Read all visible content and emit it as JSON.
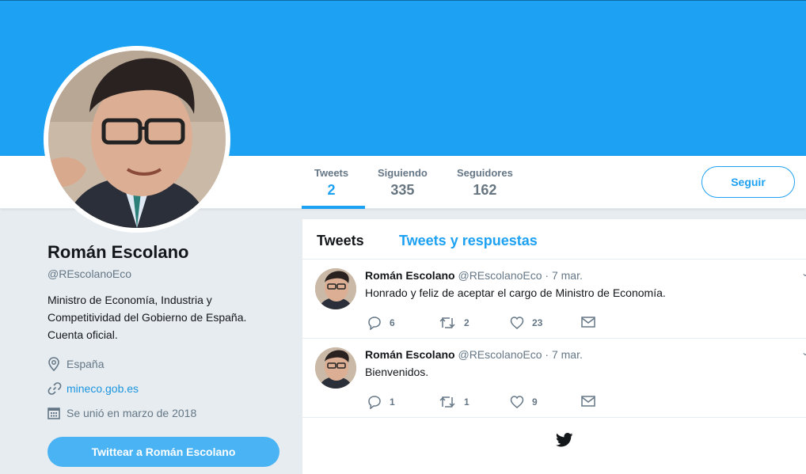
{
  "profile": {
    "name": "Román Escolano",
    "handle": "@REscolanoEco",
    "bio": "Ministro de Economía, Industria y Competitividad del Gobierno de España. Cuenta oficial.",
    "location": "España",
    "website": "mineco.gob.es",
    "joined": "Se unió en marzo de 2018"
  },
  "stats": [
    {
      "label": "Tweets",
      "value": "2"
    },
    {
      "label": "Siguiendo",
      "value": "335"
    },
    {
      "label": "Seguidores",
      "value": "162"
    }
  ],
  "follow_label": "Seguir",
  "tweet_to_label": "Twittear a Román Escolano",
  "timeline": {
    "tabs": [
      "Tweets",
      "Tweets y respuestas"
    ],
    "tweets": [
      {
        "name": "Román Escolano",
        "handle": "@REscolanoEco",
        "time": "· 7 mar.",
        "text": "Honrado y feliz de aceptar el cargo de Ministro de Economía.",
        "replies": "6",
        "retweets": "2",
        "likes": "23"
      },
      {
        "name": "Román Escolano",
        "handle": "@REscolanoEco",
        "time": "· 7 mar.",
        "text": "Bienvenidos.",
        "replies": "1",
        "retweets": "1",
        "likes": "9"
      }
    ]
  },
  "colors": {
    "accent": "#1da1f2",
    "banner": "#1da1f2",
    "background": "#e6ecf0"
  }
}
